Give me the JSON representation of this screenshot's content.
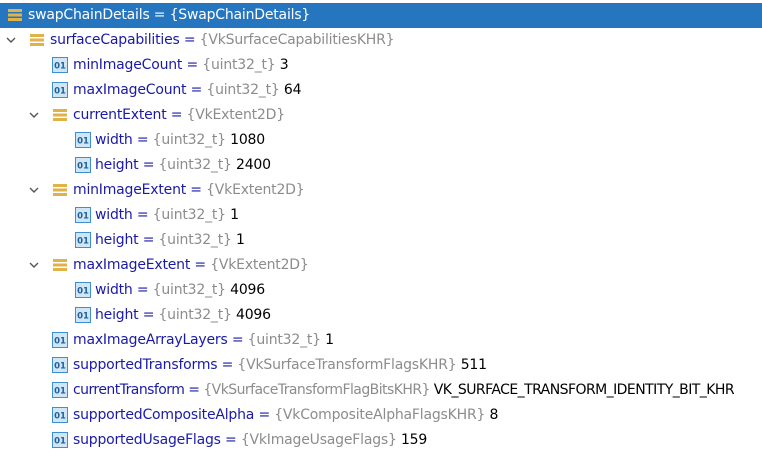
{
  "colors": {
    "selection": "#2675bf",
    "name": "#1a1aa6",
    "type": "#8c8c8c",
    "object_icon": "#e0b24a",
    "primitive_icon": "#3d8fd1"
  },
  "rows": [
    {
      "name": "swapChainDetails",
      "type": "{SwapChainDetails}",
      "value": "",
      "icon": "object-icon",
      "expanded": false,
      "selected": true
    },
    {
      "name": "surfaceCapabilities",
      "type": "{VkSurfaceCapabilitiesKHR}",
      "value": "",
      "icon": "object-icon",
      "expanded": true,
      "selected": false
    },
    {
      "name": "minImageCount",
      "type": "{uint32_t}",
      "value": "3",
      "icon": "primitive-icon",
      "selected": false
    },
    {
      "name": "maxImageCount",
      "type": "{uint32_t}",
      "value": "64",
      "icon": "primitive-icon",
      "selected": false
    },
    {
      "name": "currentExtent",
      "type": "{VkExtent2D}",
      "value": "",
      "icon": "object-icon",
      "expanded": true,
      "selected": false
    },
    {
      "name": "width",
      "type": "{uint32_t}",
      "value": "1080",
      "icon": "primitive-icon",
      "selected": false
    },
    {
      "name": "height",
      "type": "{uint32_t}",
      "value": "2400",
      "icon": "primitive-icon",
      "selected": false
    },
    {
      "name": "minImageExtent",
      "type": "{VkExtent2D}",
      "value": "",
      "icon": "object-icon",
      "expanded": true,
      "selected": false
    },
    {
      "name": "width",
      "type": "{uint32_t}",
      "value": "1",
      "icon": "primitive-icon",
      "selected": false
    },
    {
      "name": "height",
      "type": "{uint32_t}",
      "value": "1",
      "icon": "primitive-icon",
      "selected": false
    },
    {
      "name": "maxImageExtent",
      "type": "{VkExtent2D}",
      "value": "",
      "icon": "object-icon",
      "expanded": true,
      "selected": false
    },
    {
      "name": "width",
      "type": "{uint32_t}",
      "value": "4096",
      "icon": "primitive-icon",
      "selected": false
    },
    {
      "name": "height",
      "type": "{uint32_t}",
      "value": "4096",
      "icon": "primitive-icon",
      "selected": false
    },
    {
      "name": "maxImageArrayLayers",
      "type": "{uint32_t}",
      "value": "1",
      "icon": "primitive-icon",
      "selected": false
    },
    {
      "name": "supportedTransforms",
      "type": "{VkSurfaceTransformFlagsKHR}",
      "value": "511",
      "icon": "primitive-icon",
      "selected": false
    },
    {
      "name": "currentTransform",
      "type": "{VkSurfaceTransformFlagBitsKHR}",
      "value": "VK_SURFACE_TRANSFORM_IDENTITY_BIT_KHR",
      "icon": "primitive-icon",
      "selected": false
    },
    {
      "name": "supportedCompositeAlpha",
      "type": "{VkCompositeAlphaFlagsKHR}",
      "value": "8",
      "icon": "primitive-icon",
      "selected": false
    },
    {
      "name": "supportedUsageFlags",
      "type": "{VkImageUsageFlags}",
      "value": "159",
      "icon": "primitive-icon",
      "selected": false
    }
  ]
}
